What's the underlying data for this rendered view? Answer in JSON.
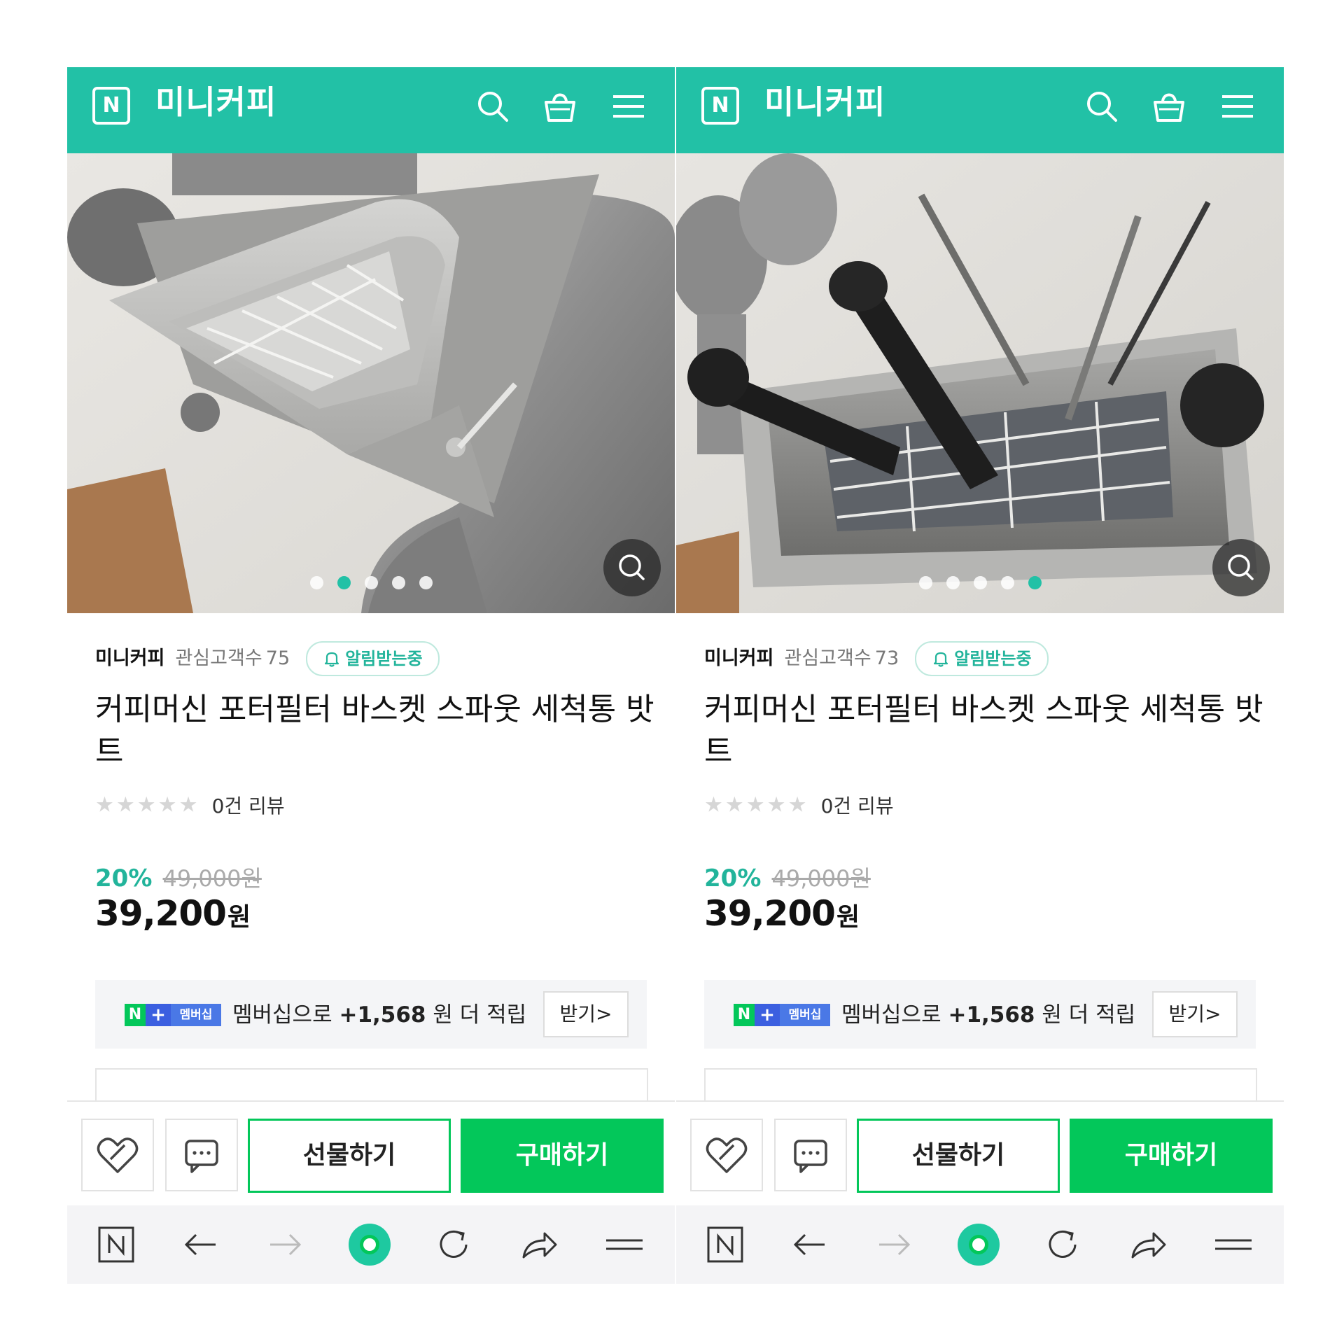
{
  "colors": {
    "brand": "#22c1a6",
    "buy_green": "#03c75a",
    "discount": "#22b49b"
  },
  "icons": {
    "header": [
      "naver-logo-icon",
      "search-icon",
      "shopping-bag-icon",
      "menu-icon"
    ],
    "bottom_bar": [
      "naver-home-icon",
      "back-arrow-icon",
      "forward-arrow-icon",
      "green-dot-icon",
      "reload-icon",
      "share-icon",
      "menu-lines-icon"
    ]
  },
  "panels": [
    {
      "header": {
        "logo_letter": "N",
        "store_title": "미니커피"
      },
      "carousel": {
        "dot_count": 5,
        "active_index": 1
      },
      "store": {
        "name": "미니커피",
        "fans_label": "관심고객수",
        "fans_count": "75",
        "alarm_label": "알림받는중"
      },
      "product": {
        "title": "커피머신 포터필터 바스켓 스파웃 세척통 밧트",
        "review_text": "0건 리뷰",
        "stars_filled": 0
      },
      "pricing": {
        "discount": "20%",
        "original_price": "49,000원",
        "price": "39,200",
        "currency": "원"
      },
      "membership": {
        "badge_n": "N",
        "badge_plus": "+",
        "badge_label": "멤버십",
        "text_before": "멤버십으로",
        "amount": "+1,568",
        "text_after": "원 더 적립",
        "button_label": "받기>"
      },
      "actions": {
        "gift": "선물하기",
        "buy": "구매하기"
      }
    },
    {
      "header": {
        "logo_letter": "N",
        "store_title": "미니커피"
      },
      "carousel": {
        "dot_count": 5,
        "active_index": 4
      },
      "store": {
        "name": "미니커피",
        "fans_label": "관심고객수",
        "fans_count": "73",
        "alarm_label": "알림받는중"
      },
      "product": {
        "title": "커피머신 포터필터 바스켓 스파웃 세척통 밧트",
        "review_text": "0건 리뷰",
        "stars_filled": 0
      },
      "pricing": {
        "discount": "20%",
        "original_price": "49,000원",
        "price": "39,200",
        "currency": "원"
      },
      "membership": {
        "badge_n": "N",
        "badge_plus": "+",
        "badge_label": "멤버십",
        "text_before": "멤버십으로",
        "amount": "+1,568",
        "text_after": "원 더 적립",
        "button_label": "받기>"
      },
      "actions": {
        "gift": "선물하기",
        "buy": "구매하기"
      }
    }
  ]
}
